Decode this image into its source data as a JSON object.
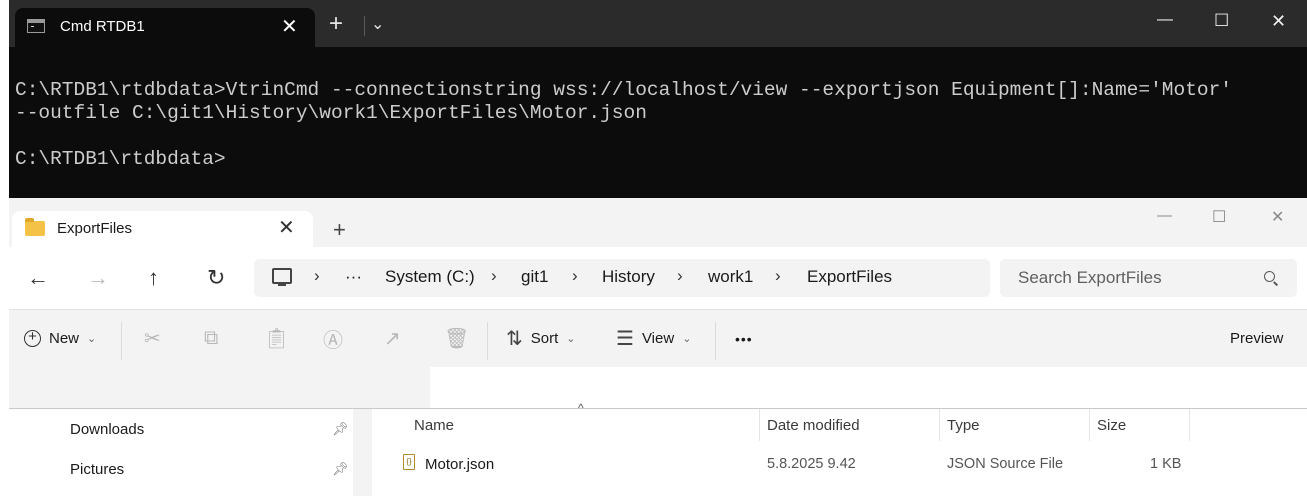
{
  "terminal": {
    "tab_title": "Cmd RTDB1",
    "new_tab": "+",
    "dropdown": "⌄",
    "window_controls": {
      "minimize": "—",
      "maximize": "☐",
      "close": "✕"
    },
    "lines": [
      "C:\\RTDB1\\rtdbdata>VtrinCmd --connectionstring wss://localhost/view --exportjson Equipment[]:Name='Motor'",
      "--outfile C:\\git1\\History\\work1\\ExportFiles\\Motor.json",
      "",
      "C:\\RTDB1\\rtdbdata>"
    ]
  },
  "explorer": {
    "tab_title": "ExportFiles",
    "new_tab": "+",
    "window_controls": {
      "minimize": "—",
      "maximize": "☐",
      "close": "✕"
    },
    "nav": {
      "back": "←",
      "forward": "→",
      "up": "↑",
      "refresh": "↻"
    },
    "address": {
      "more": "···",
      "crumbs": [
        "System (C:)",
        "git1",
        "History",
        "work1",
        "ExportFiles"
      ]
    },
    "search_placeholder": "Search ExportFiles",
    "toolbar": {
      "new_label": "New",
      "sort_label": "Sort",
      "view_label": "View",
      "more": "•••",
      "preview_label": "Preview"
    },
    "nav_pane": [
      {
        "label": "Downloads",
        "pinned": true
      },
      {
        "label": "Pictures",
        "pinned": true
      }
    ],
    "columns": [
      "Name",
      "Date modified",
      "Type",
      "Size"
    ],
    "files": [
      {
        "name": "Motor.json",
        "date": "5.8.2025 9.42",
        "type": "JSON Source File",
        "size": "1 KB"
      }
    ]
  }
}
